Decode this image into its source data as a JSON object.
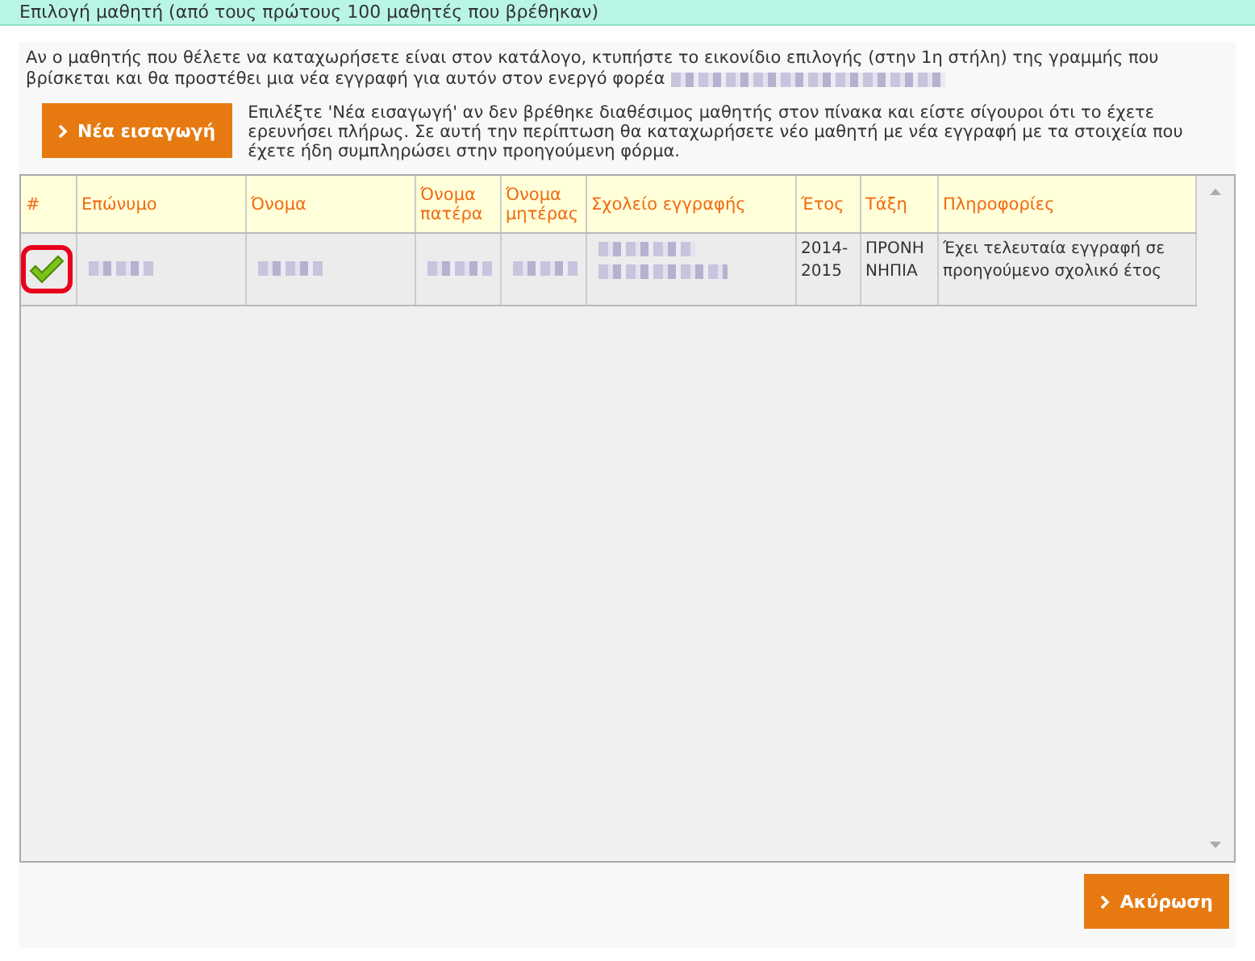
{
  "window": {
    "title": "Επιλογή μαθητή (από τους πρώτους 100 μαθητές που βρέθηκαν)"
  },
  "intro": {
    "text": "Αν ο μαθητής που θέλετε να καταχωρήσετε είναι στον κατάλογο, κτυπήστε το εικονίδιο επιλογής (στην 1η στήλη) της γραμμής που βρίσκεται και θα προστέθει μια νέα εγγραφή για αυτόν στον ενεργό φορέα",
    "blurred_tail": true
  },
  "new_entry": {
    "button": "Νέα εισαγωγή",
    "note": "Επιλέξτε 'Νέα εισαγωγή' αν δεν βρέθηκε διαθέσιμος μαθητής στον πίνακα και είστε σίγουροι ότι το έχετε ερευνήσει πλήρως. Σε αυτή την περίπτωση θα καταχωρήσετε νέο μαθητή με νέα εγγραφή με τα στοιχεία που έχετε ήδη συμπληρώσει στην προηγούμενη φόρμα."
  },
  "table": {
    "columns": [
      "#",
      "Επώνυμο",
      "Όνομα",
      "Όνομα πατέρα",
      "Όνομα μητέρας",
      "Σχολείο εγγραφής",
      "Έτος",
      "Τάξη",
      "Πληροφορίες"
    ],
    "rows": [
      {
        "selected": true,
        "cells": [
          {
            "kind": "select"
          },
          {
            "kind": "blurred"
          },
          {
            "kind": "blurred"
          },
          {
            "kind": "blurred"
          },
          {
            "kind": "blurred"
          },
          {
            "kind": "blurred2"
          },
          {
            "kind": "text",
            "text": "2014-2015"
          },
          {
            "kind": "text",
            "text": "ΠΡΟΝΗ ΝΗΠΙΑ"
          },
          {
            "kind": "text",
            "text": "Έχει τελευταία εγγραφή σε προηγούμενο σχολικό έτος"
          }
        ]
      }
    ]
  },
  "footer": {
    "button": "Ακύρωση"
  }
}
